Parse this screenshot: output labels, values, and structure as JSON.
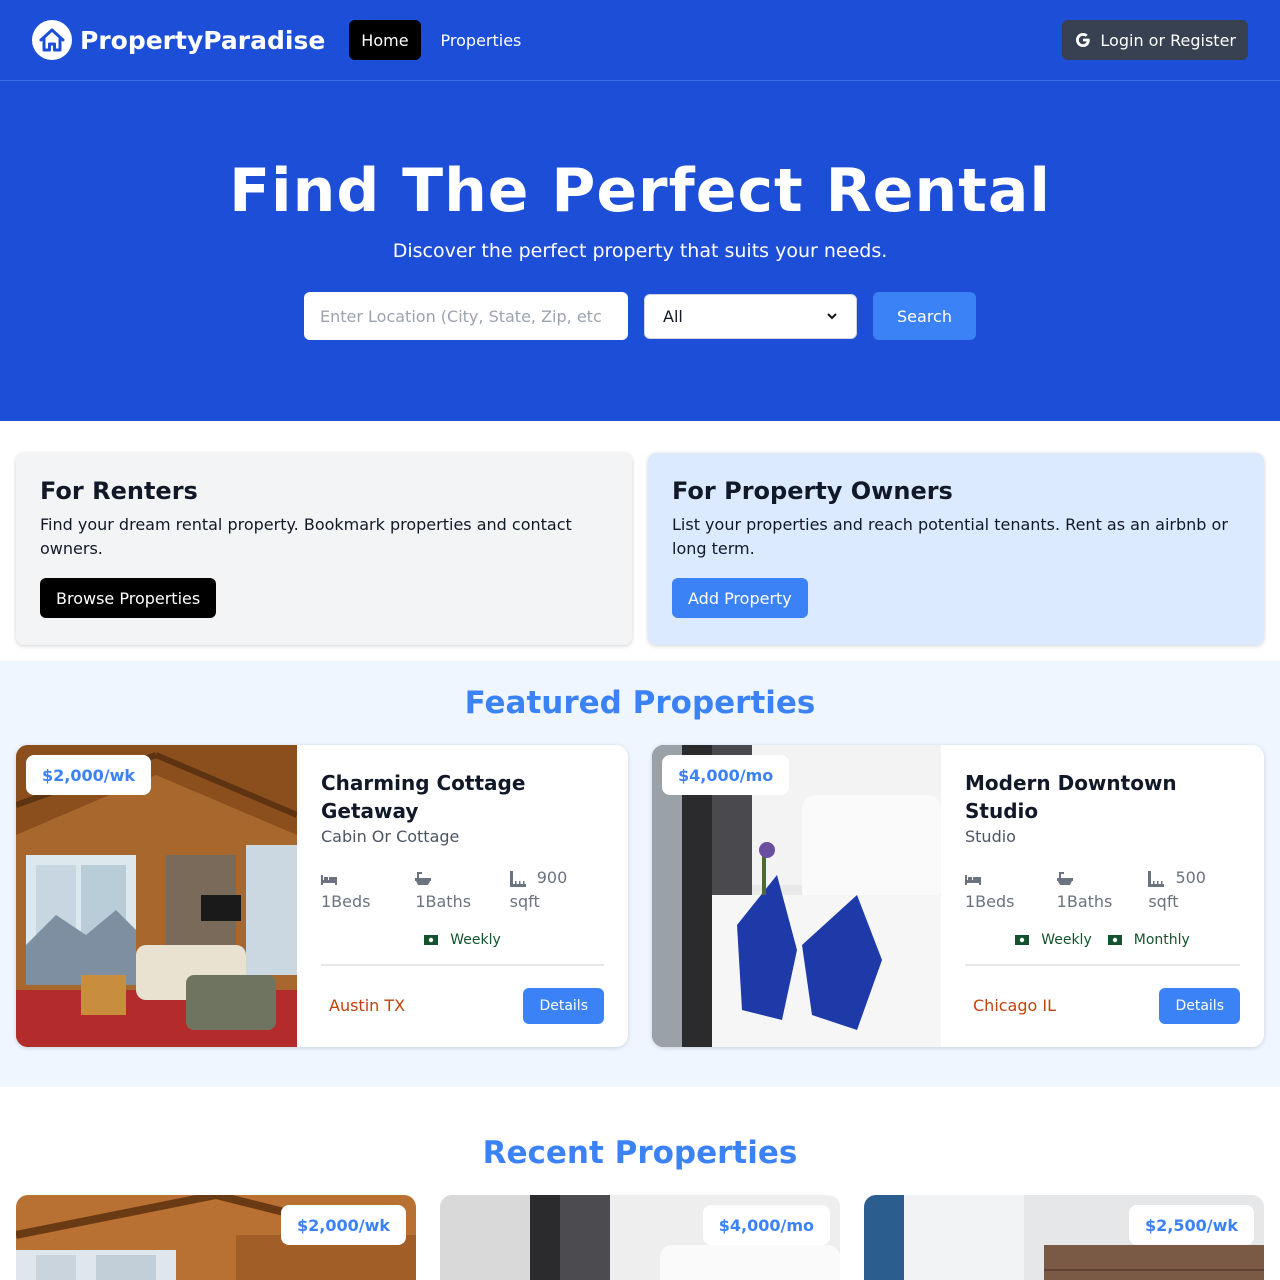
{
  "nav": {
    "brand": "PropertyParadise",
    "links": [
      {
        "label": "Home",
        "active": true
      },
      {
        "label": "Properties",
        "active": false
      }
    ],
    "login_label": "Login or Register"
  },
  "hero": {
    "title": "Find The Perfect Rental",
    "subtitle": "Discover the perfect property that suits your needs.",
    "search": {
      "location_placeholder": "Enter Location (City, State, Zip, etc",
      "type_selected": "All",
      "button_label": "Search"
    }
  },
  "info": {
    "renters": {
      "title": "For Renters",
      "text": "Find your dream rental property. Bookmark properties and contact owners.",
      "button": "Browse Properties"
    },
    "owners": {
      "title": "For Property Owners",
      "text": "List your properties and reach potential tenants. Rent as an airbnb or long term.",
      "button": "Add Property"
    }
  },
  "featured": {
    "title": "Featured Properties",
    "items": [
      {
        "price": "$2,000/wk",
        "name": "Charming Cottage Getaway",
        "type": "Cabin Or Cottage",
        "beds": "1Beds",
        "baths": "1Baths",
        "sqft_num": "900",
        "sqft_unit": "sqft",
        "rates": [
          "Weekly"
        ],
        "location": "Austin TX",
        "details_label": "Details"
      },
      {
        "price": "$4,000/mo",
        "name": "Modern Downtown Studio",
        "type": "Studio",
        "beds": "1Beds",
        "baths": "1Baths",
        "sqft_num": "500",
        "sqft_unit": "sqft",
        "rates": [
          "Weekly",
          "Monthly"
        ],
        "location": "Chicago IL",
        "details_label": "Details"
      }
    ]
  },
  "recent": {
    "title": "Recent Properties",
    "items": [
      {
        "price": "$2,000/wk"
      },
      {
        "price": "$4,000/mo"
      },
      {
        "price": "$2,500/wk"
      }
    ]
  },
  "colors": {
    "primary": "#1d4ed8",
    "accent": "#3b82f6",
    "location": "#c2410c",
    "rate": "#14532d"
  }
}
